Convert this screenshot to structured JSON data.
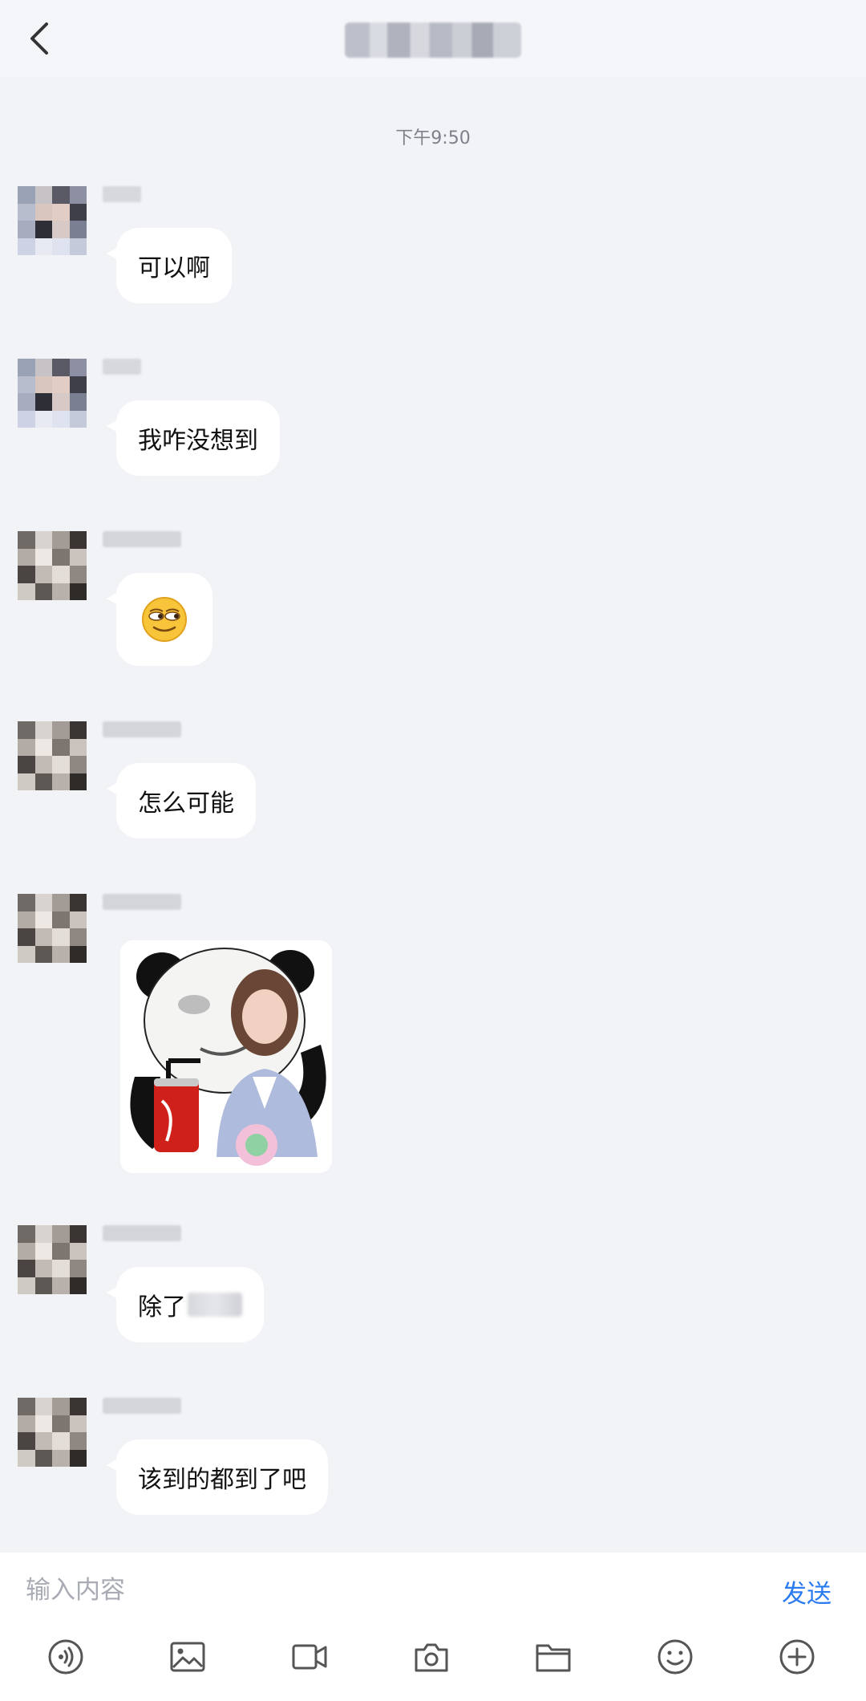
{
  "header": {
    "title": "",
    "back_icon": "chevron-left-icon"
  },
  "chat": {
    "timestamp": "下午9:50"
  },
  "messages": [
    {
      "type": "text",
      "text": "可以啊"
    },
    {
      "type": "text",
      "text": "我咋没想到"
    },
    {
      "type": "emoji",
      "emoji": "smirk-emoji"
    },
    {
      "type": "text",
      "text": "怎么可能"
    },
    {
      "type": "sticker",
      "sticker": "panda-meme-sticker"
    },
    {
      "type": "text",
      "text": "除了"
    },
    {
      "type": "text",
      "text": "该到的都到了吧"
    }
  ],
  "composer": {
    "placeholder": "输入内容",
    "send_label": "发送",
    "accent_color": "#2b7bf0",
    "tools": [
      "voice-icon",
      "image-icon",
      "video-icon",
      "camera-icon",
      "folder-icon",
      "emoji-icon",
      "plus-icon"
    ]
  }
}
